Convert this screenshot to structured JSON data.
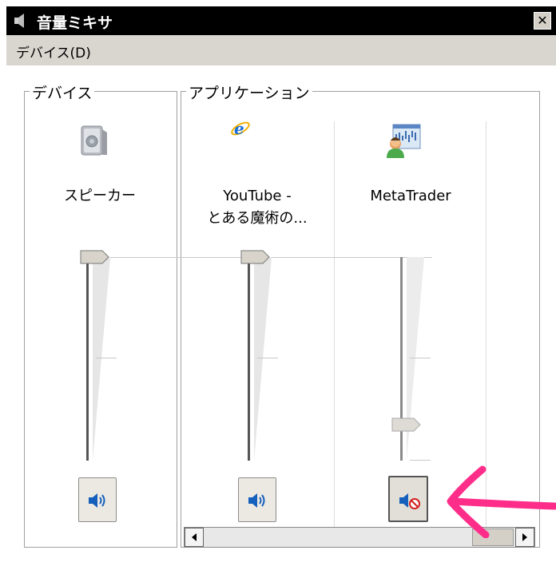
{
  "window": {
    "title": "音量ミキサ",
    "close_label": "✕"
  },
  "menu": {
    "device_label": "デバイス(D)"
  },
  "groups": {
    "device": {
      "label": "デバイス"
    },
    "applications": {
      "label": "アプリケーション"
    }
  },
  "channels": [
    {
      "name": "スピーカー",
      "icon": "speaker-icon",
      "volume_level": 1.0,
      "muted": false
    },
    {
      "name": "YouTube -\nとある魔術の...",
      "icon": "internet-explorer-icon",
      "volume_level": 1.0,
      "muted": false
    },
    {
      "name": "MetaTrader",
      "icon": "metatrader-icon",
      "volume_level": 0.2,
      "muted": true
    }
  ],
  "annotation": {
    "color": "#ff2d8a"
  },
  "colors": {
    "titlebar": "#000000",
    "menubar": "#d9d6d0",
    "accent_blue": "#1560bd",
    "mute_red": "#d22020"
  }
}
